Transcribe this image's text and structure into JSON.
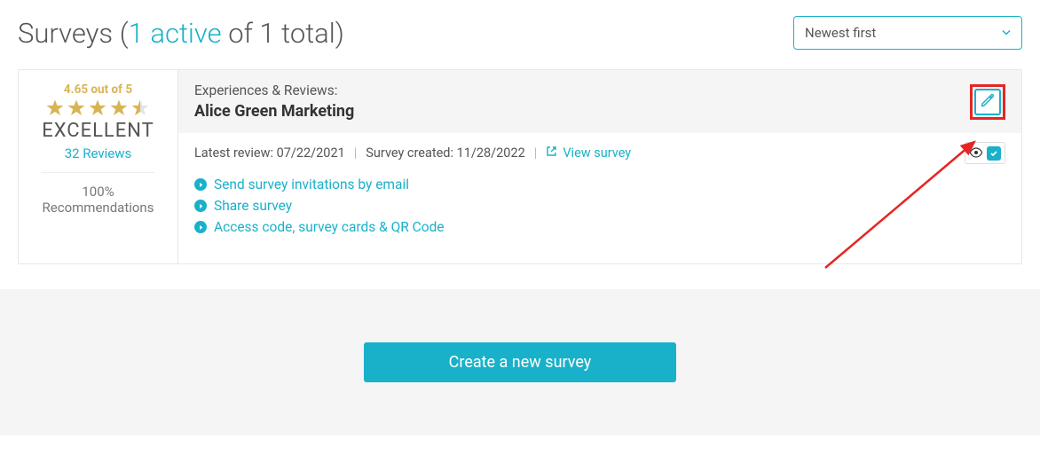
{
  "header": {
    "title_prefix": "Surveys ",
    "paren_open": "(",
    "active_text": "1 active",
    "of_total_text": " of 1 total",
    "paren_close": ")"
  },
  "sort": {
    "selected": "Newest first"
  },
  "rating": {
    "score_text": "4.65 out of 5",
    "grade": "EXCELLENT",
    "reviews_text": "32 Reviews",
    "rec_pct": "100%",
    "rec_label": "Recommendations"
  },
  "survey": {
    "experiences_label": "Experiences & Reviews:",
    "name": "Alice Green Marketing",
    "latest_review_label": "Latest review: ",
    "latest_review_date": "07/22/2021",
    "created_label": "Survey created: ",
    "created_date": "11/28/2022",
    "view_label": "View survey"
  },
  "actions": {
    "send_email": "Send survey invitations by email",
    "share": "Share survey",
    "access": "Access code, survey cards & QR Code"
  },
  "footer": {
    "create_label": "Create a new survey"
  }
}
